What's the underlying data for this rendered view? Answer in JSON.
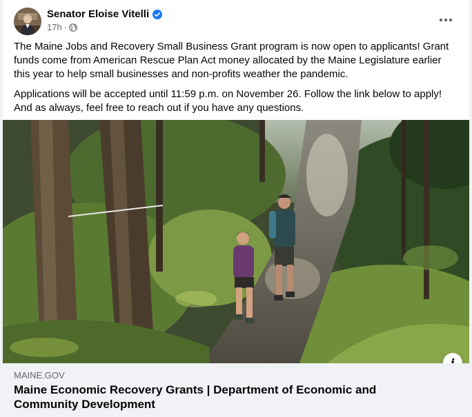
{
  "post": {
    "author": "Senator Eloise Vitelli",
    "timestamp": "17h",
    "separator": "·",
    "verified_icon": "verified-badge-icon",
    "privacy_icon": "globe-icon",
    "more_icon": "more-options-icon",
    "paragraphs": [
      "The Maine Jobs and Recovery Small Business Grant program is now open to applicants! Grant funds come from American Rescue Plan Act money allocated by the Maine Legislature earlier this year to help small businesses and non-profits weather the pandemic.",
      "Applications will be accepted until 11:59 p.m. on November 26. Follow the link below to apply! And as always, feel free to reach out if you have any questions."
    ]
  },
  "link_preview": {
    "domain": "MAINE.GOV",
    "title": "Maine Economic Recovery Grants | Department of Economic and Community Development",
    "info_label": "i"
  },
  "colors": {
    "verified": "#1877f2",
    "secondary_text": "#65676b",
    "card_background": "#f0f2f5"
  }
}
